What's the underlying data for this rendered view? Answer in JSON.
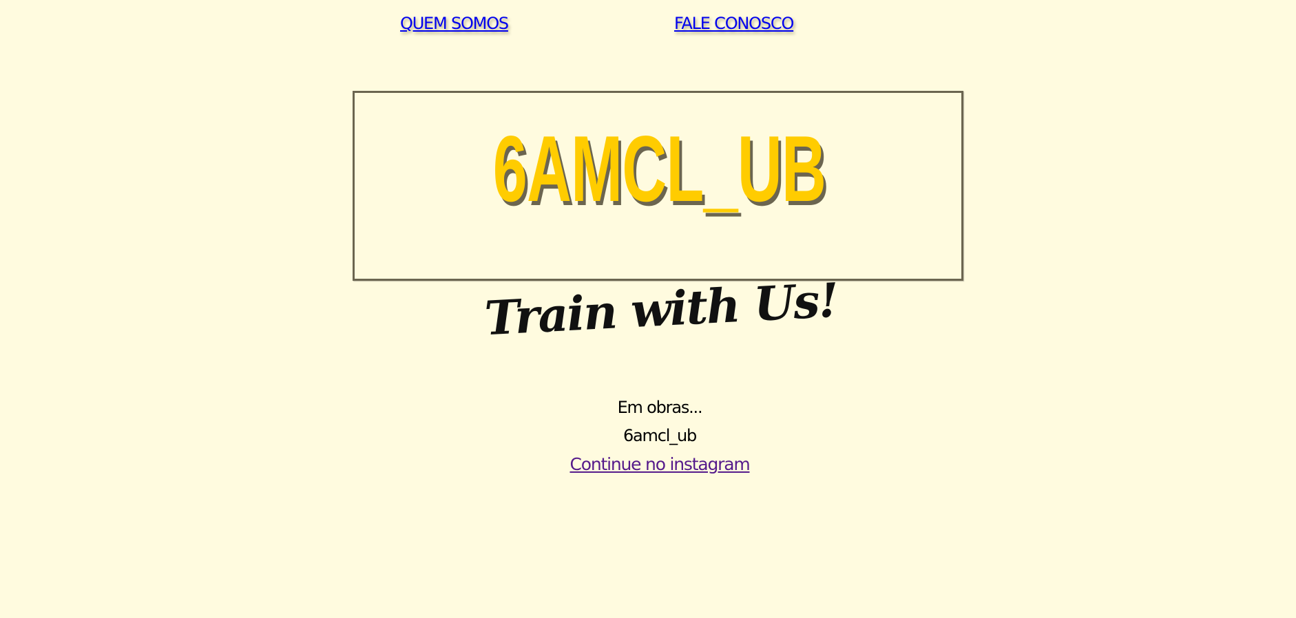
{
  "nav": {
    "quem_somos": "QUEM SOMOS",
    "fale_conosco": "FALE CONOSCO"
  },
  "logo": {
    "wordmark": "6AMCL_UB",
    "tagline": "Train with Us!"
  },
  "content": {
    "status": "Em obras...",
    "handle": "6amcl_ub",
    "instagram_link": "Continue no instagram"
  },
  "colors": {
    "background": "#fffbdf",
    "logo_yellow": "#ffcc00",
    "logo_frame": "#6b6550",
    "link_unvisited": "#0000ee",
    "link_visited": "#551a8b"
  }
}
